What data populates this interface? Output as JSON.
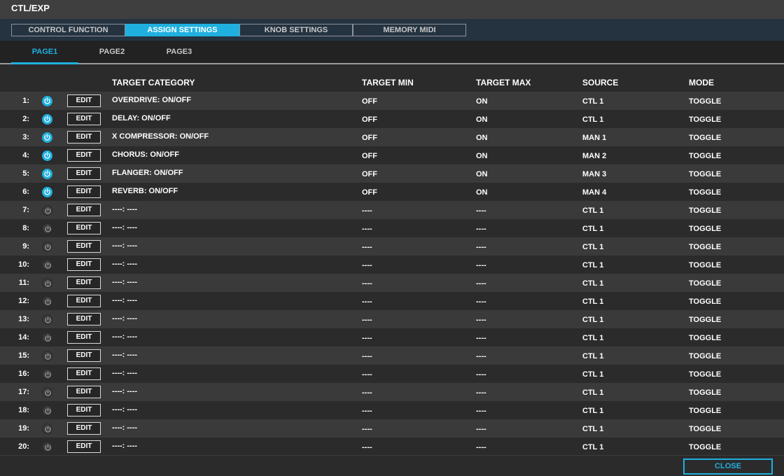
{
  "window": {
    "title": "CTL/EXP"
  },
  "tabs": [
    {
      "label": "CONTROL FUNCTION",
      "active": false
    },
    {
      "label": "ASSIGN SETTINGS",
      "active": true
    },
    {
      "label": "KNOB SETTINGS",
      "active": false
    },
    {
      "label": "MEMORY MIDI",
      "active": false
    }
  ],
  "pages": [
    {
      "label": "PAGE1",
      "active": true
    },
    {
      "label": "PAGE2",
      "active": false
    },
    {
      "label": "PAGE3",
      "active": false
    }
  ],
  "columns": {
    "target_category": "TARGET CATEGORY",
    "target_min": "TARGET MIN",
    "target_max": "TARGET MAX",
    "source": "SOURCE",
    "mode": "MODE"
  },
  "edit_label": "EDIT",
  "close_label": "CLOSE",
  "colors": {
    "accent": "#1fb0e0",
    "row_alt": "#3a3a3a",
    "background": "#2b2b2b"
  },
  "rows": [
    {
      "num": "1:",
      "on": true,
      "target": "OVERDRIVE: ON/OFF",
      "min": "OFF",
      "max": "ON",
      "source": "CTL 1",
      "mode": "TOGGLE"
    },
    {
      "num": "2:",
      "on": true,
      "target": "DELAY: ON/OFF",
      "min": "OFF",
      "max": "ON",
      "source": "CTL 1",
      "mode": "TOGGLE"
    },
    {
      "num": "3:",
      "on": true,
      "target": "X COMPRESSOR: ON/OFF",
      "min": "OFF",
      "max": "ON",
      "source": "MAN 1",
      "mode": "TOGGLE"
    },
    {
      "num": "4:",
      "on": true,
      "target": "CHORUS: ON/OFF",
      "min": "OFF",
      "max": "ON",
      "source": "MAN 2",
      "mode": "TOGGLE"
    },
    {
      "num": "5:",
      "on": true,
      "target": "FLANGER: ON/OFF",
      "min": "OFF",
      "max": "ON",
      "source": "MAN 3",
      "mode": "TOGGLE"
    },
    {
      "num": "6:",
      "on": true,
      "target": "REVERB: ON/OFF",
      "min": "OFF",
      "max": "ON",
      "source": "MAN 4",
      "mode": "TOGGLE"
    },
    {
      "num": "7:",
      "on": false,
      "target": "----: ----",
      "min": "----",
      "max": "----",
      "source": "CTL 1",
      "mode": "TOGGLE"
    },
    {
      "num": "8:",
      "on": false,
      "target": "----: ----",
      "min": "----",
      "max": "----",
      "source": "CTL 1",
      "mode": "TOGGLE"
    },
    {
      "num": "9:",
      "on": false,
      "target": "----: ----",
      "min": "----",
      "max": "----",
      "source": "CTL 1",
      "mode": "TOGGLE"
    },
    {
      "num": "10:",
      "on": false,
      "target": "----: ----",
      "min": "----",
      "max": "----",
      "source": "CTL 1",
      "mode": "TOGGLE"
    },
    {
      "num": "11:",
      "on": false,
      "target": "----: ----",
      "min": "----",
      "max": "----",
      "source": "CTL 1",
      "mode": "TOGGLE"
    },
    {
      "num": "12:",
      "on": false,
      "target": "----: ----",
      "min": "----",
      "max": "----",
      "source": "CTL 1",
      "mode": "TOGGLE"
    },
    {
      "num": "13:",
      "on": false,
      "target": "----: ----",
      "min": "----",
      "max": "----",
      "source": "CTL 1",
      "mode": "TOGGLE"
    },
    {
      "num": "14:",
      "on": false,
      "target": "----: ----",
      "min": "----",
      "max": "----",
      "source": "CTL 1",
      "mode": "TOGGLE"
    },
    {
      "num": "15:",
      "on": false,
      "target": "----: ----",
      "min": "----",
      "max": "----",
      "source": "CTL 1",
      "mode": "TOGGLE"
    },
    {
      "num": "16:",
      "on": false,
      "target": "----: ----",
      "min": "----",
      "max": "----",
      "source": "CTL 1",
      "mode": "TOGGLE"
    },
    {
      "num": "17:",
      "on": false,
      "target": "----: ----",
      "min": "----",
      "max": "----",
      "source": "CTL 1",
      "mode": "TOGGLE"
    },
    {
      "num": "18:",
      "on": false,
      "target": "----: ----",
      "min": "----",
      "max": "----",
      "source": "CTL 1",
      "mode": "TOGGLE"
    },
    {
      "num": "19:",
      "on": false,
      "target": "----: ----",
      "min": "----",
      "max": "----",
      "source": "CTL 1",
      "mode": "TOGGLE"
    },
    {
      "num": "20:",
      "on": false,
      "target": "----: ----",
      "min": "----",
      "max": "----",
      "source": "CTL 1",
      "mode": "TOGGLE"
    }
  ]
}
